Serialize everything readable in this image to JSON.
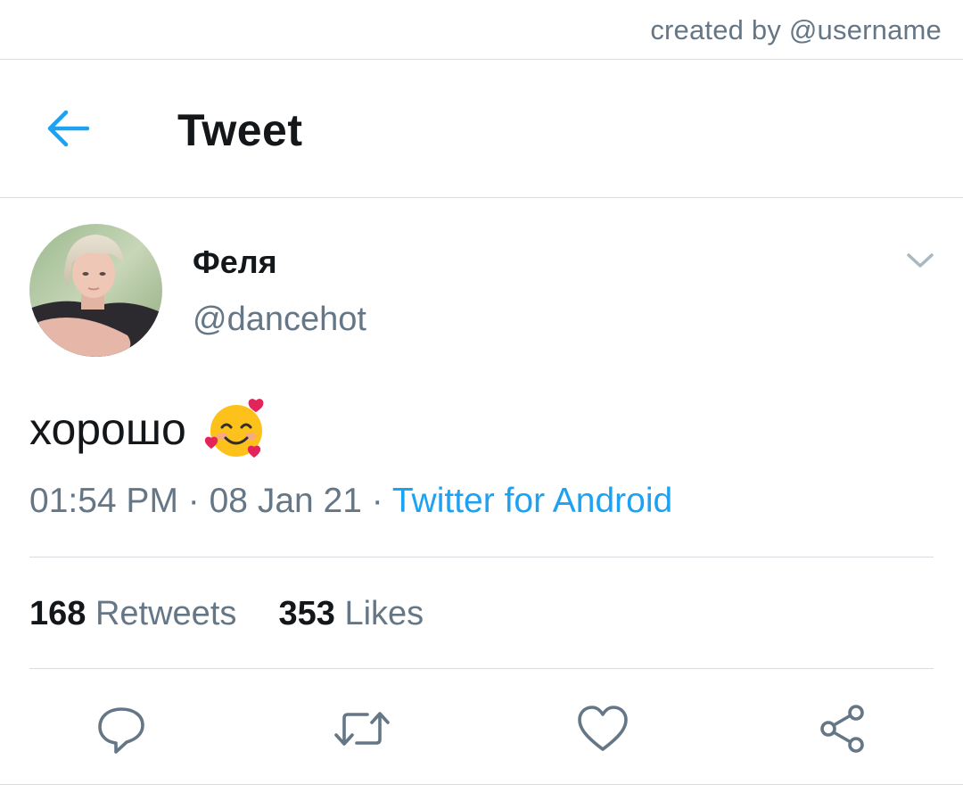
{
  "credit": {
    "text": "created by @username"
  },
  "header": {
    "title": "Tweet",
    "back_icon": "arrow-left-icon"
  },
  "tweet": {
    "display_name": "Феля",
    "handle": "@dancehot",
    "text": "хорошо",
    "emoji": "smiling-face-with-hearts",
    "time": "01:54 PM",
    "date": "08 Jan 21",
    "separator": " · ",
    "source": "Twitter for Android",
    "retweets_count": "168",
    "retweets_label": "Retweets",
    "likes_count": "353",
    "likes_label": "Likes"
  },
  "actions": [
    "reply-icon",
    "retweet-icon",
    "like-icon",
    "share-icon"
  ],
  "colors": {
    "accent": "#1da1f2",
    "text_primary": "#14171a",
    "text_secondary": "#657786",
    "icon": "#657786",
    "divider": "#d9dde1"
  }
}
